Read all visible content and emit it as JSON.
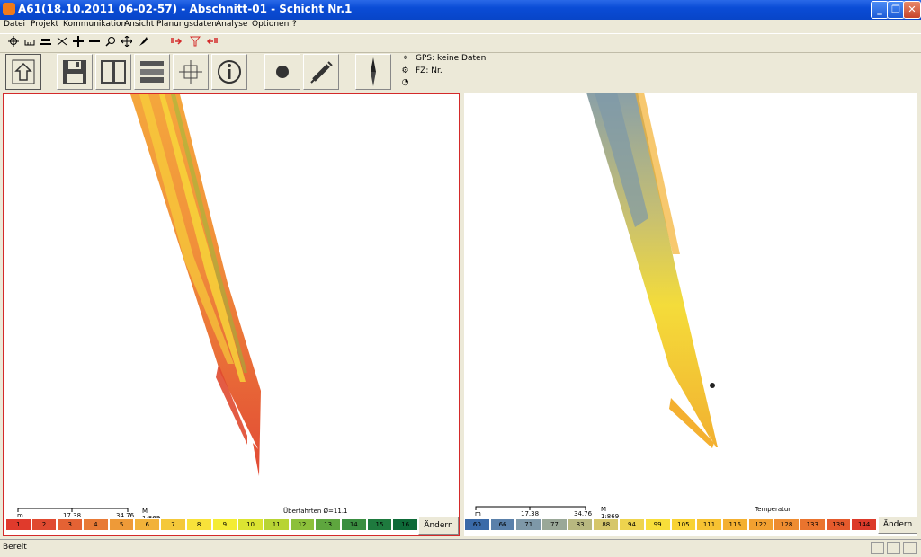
{
  "window": {
    "title": "A61(18.10.2011 06-02-57) - Abschnitt-01 - Schicht Nr.1",
    "buttons": [
      "_",
      "❐",
      "✕"
    ]
  },
  "menu": [
    "Datei",
    "Projekt",
    "Kommunikation",
    "Ansicht",
    "Planungsdaten",
    "Analyse",
    "Optionen",
    "?"
  ],
  "toolbar_small": [
    "crosshair-icon",
    "ruler-icon",
    "roller-icon",
    "split-icon",
    "plus-icon",
    "minus-icon",
    "magnifier-icon",
    "move-icon",
    "pin-icon",
    "red-arrow-right-icon",
    "filter-icon",
    "red-arrow-left-icon"
  ],
  "toolbar_big": [
    "home-icon",
    "save-icon",
    "split-view-icon",
    "layers-icon",
    "target-icon",
    "info-icon",
    "record-icon",
    "satellite-icon",
    "north-arrow-icon"
  ],
  "info": {
    "gps_label": "GPS:",
    "gps_value": "keine Daten",
    "fz_label": "FZ: Nr."
  },
  "left_view": {
    "scale_m": "m",
    "scale_mid": "17.38",
    "scale_end": "34.76",
    "scale_ratio": "M 1:869",
    "caption": "Überfahrten Ø=11.1",
    "legend": [
      "1",
      "2",
      "3",
      "4",
      "5",
      "6",
      "7",
      "8",
      "9",
      "10",
      "11",
      "12",
      "13",
      "14",
      "15",
      "16"
    ],
    "legend_colors": [
      "#e03a2c",
      "#e04a30",
      "#e46234",
      "#e87a36",
      "#ee9a38",
      "#f2b23a",
      "#f4c83a",
      "#f8e23a",
      "#f4ec34",
      "#dce432",
      "#b8d434",
      "#8cc03a",
      "#5ea63e",
      "#3a8e40",
      "#1e7a3e",
      "#0e6a38"
    ],
    "change_btn": "Ändern"
  },
  "right_view": {
    "scale_m": "m",
    "scale_mid": "17.38",
    "scale_end": "34.76",
    "scale_ratio": "M 1:869",
    "caption": "Temperatur",
    "legend": [
      "60",
      "66",
      "71",
      "77",
      "83",
      "88",
      "94",
      "99",
      "105",
      "111",
      "116",
      "122",
      "128",
      "133",
      "139",
      "144"
    ],
    "legend_colors": [
      "#3a6aa8",
      "#5a80aa",
      "#7e98a8",
      "#9aa898",
      "#b8b880",
      "#d6c66a",
      "#eed44e",
      "#f8de3a",
      "#f8d234",
      "#f6c232",
      "#f4b030",
      "#f2a030",
      "#ee8c30",
      "#ea742e",
      "#e45a2c",
      "#dc3a2a"
    ],
    "change_btn": "Ändern"
  },
  "status": {
    "text": "Bereit"
  }
}
